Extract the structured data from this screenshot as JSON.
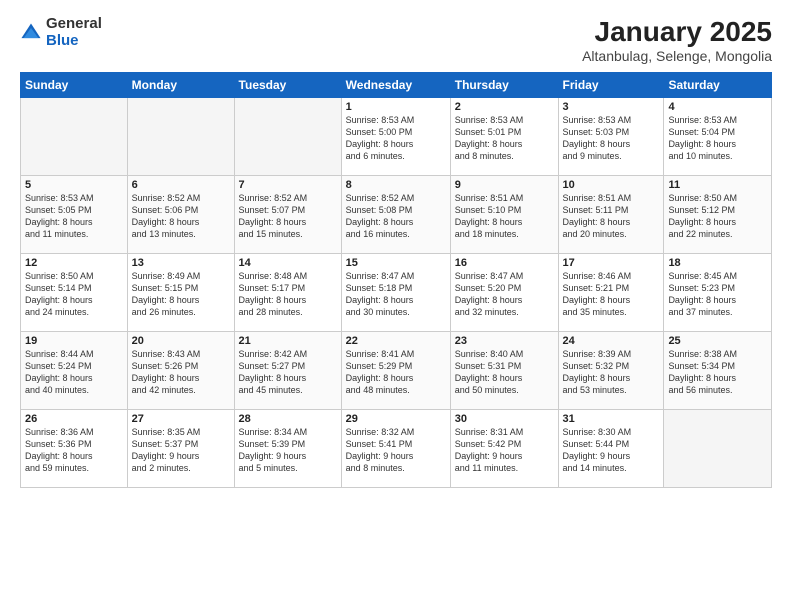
{
  "logo": {
    "general": "General",
    "blue": "Blue"
  },
  "title": "January 2025",
  "subtitle": "Altanbulag, Selenge, Mongolia",
  "days_of_week": [
    "Sunday",
    "Monday",
    "Tuesday",
    "Wednesday",
    "Thursday",
    "Friday",
    "Saturday"
  ],
  "weeks": [
    [
      {
        "day": "",
        "info": ""
      },
      {
        "day": "",
        "info": ""
      },
      {
        "day": "",
        "info": ""
      },
      {
        "day": "1",
        "info": "Sunrise: 8:53 AM\nSunset: 5:00 PM\nDaylight: 8 hours\nand 6 minutes."
      },
      {
        "day": "2",
        "info": "Sunrise: 8:53 AM\nSunset: 5:01 PM\nDaylight: 8 hours\nand 8 minutes."
      },
      {
        "day": "3",
        "info": "Sunrise: 8:53 AM\nSunset: 5:03 PM\nDaylight: 8 hours\nand 9 minutes."
      },
      {
        "day": "4",
        "info": "Sunrise: 8:53 AM\nSunset: 5:04 PM\nDaylight: 8 hours\nand 10 minutes."
      }
    ],
    [
      {
        "day": "5",
        "info": "Sunrise: 8:53 AM\nSunset: 5:05 PM\nDaylight: 8 hours\nand 11 minutes."
      },
      {
        "day": "6",
        "info": "Sunrise: 8:52 AM\nSunset: 5:06 PM\nDaylight: 8 hours\nand 13 minutes."
      },
      {
        "day": "7",
        "info": "Sunrise: 8:52 AM\nSunset: 5:07 PM\nDaylight: 8 hours\nand 15 minutes."
      },
      {
        "day": "8",
        "info": "Sunrise: 8:52 AM\nSunset: 5:08 PM\nDaylight: 8 hours\nand 16 minutes."
      },
      {
        "day": "9",
        "info": "Sunrise: 8:51 AM\nSunset: 5:10 PM\nDaylight: 8 hours\nand 18 minutes."
      },
      {
        "day": "10",
        "info": "Sunrise: 8:51 AM\nSunset: 5:11 PM\nDaylight: 8 hours\nand 20 minutes."
      },
      {
        "day": "11",
        "info": "Sunrise: 8:50 AM\nSunset: 5:12 PM\nDaylight: 8 hours\nand 22 minutes."
      }
    ],
    [
      {
        "day": "12",
        "info": "Sunrise: 8:50 AM\nSunset: 5:14 PM\nDaylight: 8 hours\nand 24 minutes."
      },
      {
        "day": "13",
        "info": "Sunrise: 8:49 AM\nSunset: 5:15 PM\nDaylight: 8 hours\nand 26 minutes."
      },
      {
        "day": "14",
        "info": "Sunrise: 8:48 AM\nSunset: 5:17 PM\nDaylight: 8 hours\nand 28 minutes."
      },
      {
        "day": "15",
        "info": "Sunrise: 8:47 AM\nSunset: 5:18 PM\nDaylight: 8 hours\nand 30 minutes."
      },
      {
        "day": "16",
        "info": "Sunrise: 8:47 AM\nSunset: 5:20 PM\nDaylight: 8 hours\nand 32 minutes."
      },
      {
        "day": "17",
        "info": "Sunrise: 8:46 AM\nSunset: 5:21 PM\nDaylight: 8 hours\nand 35 minutes."
      },
      {
        "day": "18",
        "info": "Sunrise: 8:45 AM\nSunset: 5:23 PM\nDaylight: 8 hours\nand 37 minutes."
      }
    ],
    [
      {
        "day": "19",
        "info": "Sunrise: 8:44 AM\nSunset: 5:24 PM\nDaylight: 8 hours\nand 40 minutes."
      },
      {
        "day": "20",
        "info": "Sunrise: 8:43 AM\nSunset: 5:26 PM\nDaylight: 8 hours\nand 42 minutes."
      },
      {
        "day": "21",
        "info": "Sunrise: 8:42 AM\nSunset: 5:27 PM\nDaylight: 8 hours\nand 45 minutes."
      },
      {
        "day": "22",
        "info": "Sunrise: 8:41 AM\nSunset: 5:29 PM\nDaylight: 8 hours\nand 48 minutes."
      },
      {
        "day": "23",
        "info": "Sunrise: 8:40 AM\nSunset: 5:31 PM\nDaylight: 8 hours\nand 50 minutes."
      },
      {
        "day": "24",
        "info": "Sunrise: 8:39 AM\nSunset: 5:32 PM\nDaylight: 8 hours\nand 53 minutes."
      },
      {
        "day": "25",
        "info": "Sunrise: 8:38 AM\nSunset: 5:34 PM\nDaylight: 8 hours\nand 56 minutes."
      }
    ],
    [
      {
        "day": "26",
        "info": "Sunrise: 8:36 AM\nSunset: 5:36 PM\nDaylight: 8 hours\nand 59 minutes."
      },
      {
        "day": "27",
        "info": "Sunrise: 8:35 AM\nSunset: 5:37 PM\nDaylight: 9 hours\nand 2 minutes."
      },
      {
        "day": "28",
        "info": "Sunrise: 8:34 AM\nSunset: 5:39 PM\nDaylight: 9 hours\nand 5 minutes."
      },
      {
        "day": "29",
        "info": "Sunrise: 8:32 AM\nSunset: 5:41 PM\nDaylight: 9 hours\nand 8 minutes."
      },
      {
        "day": "30",
        "info": "Sunrise: 8:31 AM\nSunset: 5:42 PM\nDaylight: 9 hours\nand 11 minutes."
      },
      {
        "day": "31",
        "info": "Sunrise: 8:30 AM\nSunset: 5:44 PM\nDaylight: 9 hours\nand 14 minutes."
      },
      {
        "day": "",
        "info": ""
      }
    ]
  ]
}
